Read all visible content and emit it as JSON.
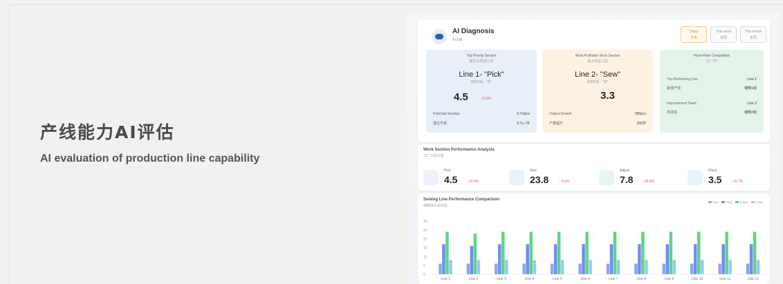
{
  "hero": {
    "title_cn": "产线能力AI评估",
    "title_en": "AI evaluation of production line capability"
  },
  "app": {
    "title": "AI Diagnosis",
    "subtitle": "AI诊断",
    "tabs": [
      {
        "label": "Today",
        "sub": "今天"
      },
      {
        "label": "This week",
        "sub": "本周"
      },
      {
        "label": "This month",
        "sub": "本月"
      }
    ],
    "panels": {
      "priority": {
        "header": "Top Priority Section",
        "header_cn": "最优先改进工段",
        "line": "Line 1- \"Pick\"",
        "line_cn": "缝制1组 - \"拿\"",
        "value": "4.5",
        "change": "15.8%",
        "k1": "Potential Savings",
        "v1": "0.7s/pcs",
        "k2": "潜在节省",
        "v2": "0.7s / 件"
      },
      "profitable": {
        "header": "Most Profitable Work Section",
        "header_cn": "最大收益工段",
        "line": "Line 2- \"Sew\"",
        "line_cn": "缝制2组 - \"缝\"",
        "value": "3.3",
        "k1": "Output Growth",
        "v1": "200pcs",
        "k2": "产量提升",
        "v2": "200件"
      },
      "plant": {
        "header": "Plant-Wide Competition",
        "header_cn": "全厂PK",
        "k1": "Top-Performing Line",
        "v1": "Line 1",
        "k2": "最佳产线",
        "v2": "缝制1组",
        "k3": "Improvement Team",
        "v3": "Line 2",
        "k4": "改进组",
        "v4": "缝制2组"
      }
    },
    "analysis": {
      "title": "Work Section Performance Analysis",
      "subtitle": "工厂工段分析",
      "metrics": [
        {
          "label": "Pick",
          "value": "4.5",
          "change": "↓ 15.4%",
          "color": "#eef0fb"
        },
        {
          "label": "Sew",
          "value": "23.8",
          "change": "↓ 4.8%",
          "color": "#e9f1fb"
        },
        {
          "label": "Adjust",
          "value": "7.8",
          "change": "↓ 25.8%",
          "color": "#e7f6ec"
        },
        {
          "label": "Place",
          "value": "3.5",
          "change": "↓ 16.7%",
          "color": "#e6f4fa"
        }
      ]
    }
  },
  "chart_data": {
    "type": "bar",
    "title": "Sewing Line Performance Comparison",
    "subtitle": "缝制线工段对比",
    "categories": [
      "Line 1",
      "Line 2",
      "Line 3",
      "Line 4",
      "Line 5",
      "Line 6",
      "Line 7",
      "Line 8",
      "Line 9",
      "Line 10",
      "Line 11",
      "Line 12"
    ],
    "ylim": [
      0,
      30
    ],
    "yticks": [
      "30",
      "25",
      "20",
      "15",
      "10",
      "5",
      "0"
    ],
    "series": [
      {
        "name": "Pick",
        "color": "#8aa6f2",
        "values": [
          6,
          6,
          6,
          6,
          6,
          6,
          6,
          6,
          6,
          6,
          6,
          6
        ]
      },
      {
        "name": "Sew",
        "color": "#6f8ee8",
        "values": [
          17,
          16,
          17,
          17,
          17,
          17,
          17,
          17,
          17,
          17,
          17,
          17
        ]
      },
      {
        "name": "Adjust",
        "color": "#5fd38a",
        "values": [
          24,
          23,
          24,
          24,
          24,
          24,
          24,
          24,
          24,
          24,
          24,
          24
        ]
      },
      {
        "name": "Place",
        "color": "#8fcdf0",
        "values": [
          8,
          8,
          8,
          8,
          8,
          8,
          8,
          8,
          8,
          8,
          8,
          8
        ]
      }
    ]
  }
}
